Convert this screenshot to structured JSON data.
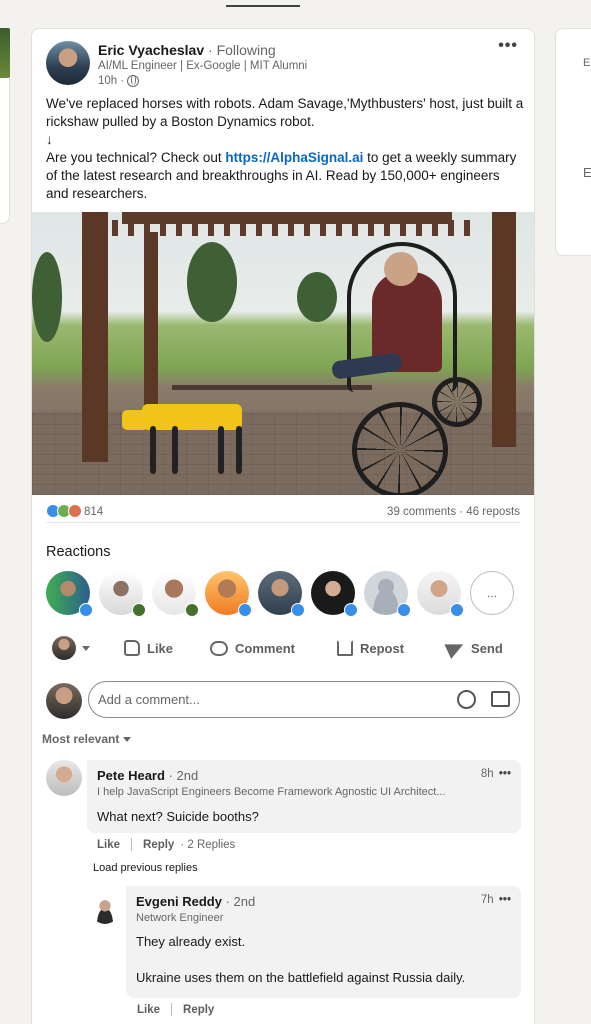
{
  "post": {
    "author": {
      "name": "Eric Vyacheslav",
      "follow_status": "· Following",
      "headline": "AI/ML Engineer | Ex-Google | MIT Alumni",
      "time": "10h ·"
    },
    "text_line1": "We've replaced horses with robots. Adam Savage,'Mythbusters' host, just built a rickshaw pulled by a Boston Dynamics robot.",
    "text_arrow": "↓",
    "text_pre_link": "Are you technical? Check out ",
    "link": "https://AlphaSignal.ai",
    "text_post_link": " to get a weekly summary of the latest research and breakthroughs in AI. Read by 150,000+ engineers and researchers.",
    "reaction_count": "814",
    "comments_reposts": "39 comments · 46 reposts"
  },
  "reactions": {
    "heading": "Reactions",
    "more_label": "..."
  },
  "actions": {
    "like": "Like",
    "comment": "Comment",
    "repost": "Repost",
    "send": "Send"
  },
  "comment_box": {
    "placeholder": "Add a comment..."
  },
  "sort": {
    "label": "Most relevant"
  },
  "comments": [
    {
      "name": "Pete Heard",
      "degree": "· 2nd",
      "headline": "I help JavaScript Engineers Become Framework Agnostic UI Architect...",
      "time": "8h",
      "body": "What next? Suicide booths?",
      "like": "Like",
      "reply": "Reply",
      "replies": "· 2 Replies"
    }
  ],
  "load_previous": "Load previous replies",
  "replies": [
    {
      "name": "Evgeni Reddy",
      "degree": "· 2nd",
      "headline": "Network Engineer",
      "time": "7h",
      "body_line1": "They already exist.",
      "body_line2": "Ukraine uses them on the battlefield against Russia daily.",
      "like": "Like",
      "reply": "Reply"
    }
  ],
  "side": {
    "right_frag_1": "Er",
    "right_frag_2": "E"
  },
  "colors": {
    "link": "#0a66c2",
    "like_blue": "#378fe9",
    "background": "#f4f2ee"
  }
}
